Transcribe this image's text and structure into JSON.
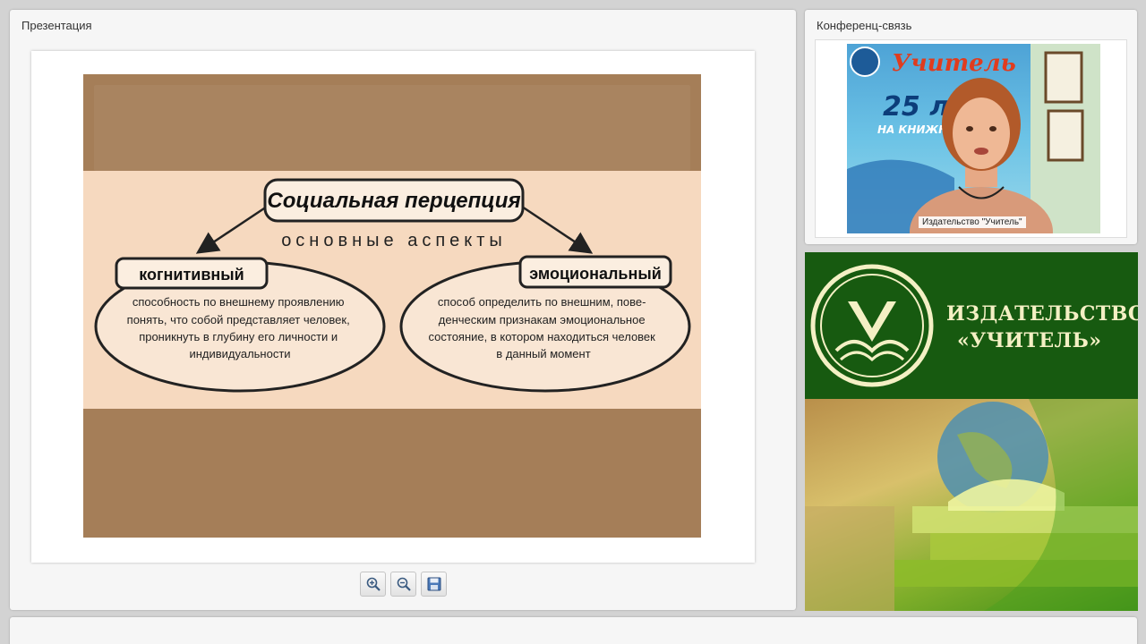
{
  "presentation": {
    "title": "Презентация",
    "slide": {
      "heading": "Социальная перцепция",
      "subheading": "основные аспекты",
      "left": {
        "label": "когнитивный",
        "lines": [
          "способность по внешнему проявлению",
          "понять, что собой представляет человек,",
          "проникнуть в глубину его личности и",
          "индивидуальности"
        ]
      },
      "right": {
        "label": "эмоциональный",
        "lines": [
          "способ определить по внешним, пове-",
          "денческим признакам эмоциональное",
          "состояние, в котором находиться человек",
          "в данный момент"
        ]
      }
    },
    "toolbar": {
      "zoom_in_icon": "zoom-in-icon",
      "zoom_out_icon": "zoom-out-icon",
      "save_icon": "save-icon"
    }
  },
  "conference": {
    "title": "Конференц-связь",
    "video_caption": "Издательство \"Учитель\"",
    "banner_lines": [
      "Учитель",
      "25 л",
      "НА КНИЖН"
    ]
  },
  "promo": {
    "line1": "ИЗДАТЕЛЬСТВО",
    "line2": "«УЧИТЕЛЬ»"
  },
  "colors": {
    "slide_bg": "#a57e58",
    "slide_band": "#f6d9bf",
    "promo_green": "#175a10",
    "promo_text": "#f4f0c4"
  }
}
